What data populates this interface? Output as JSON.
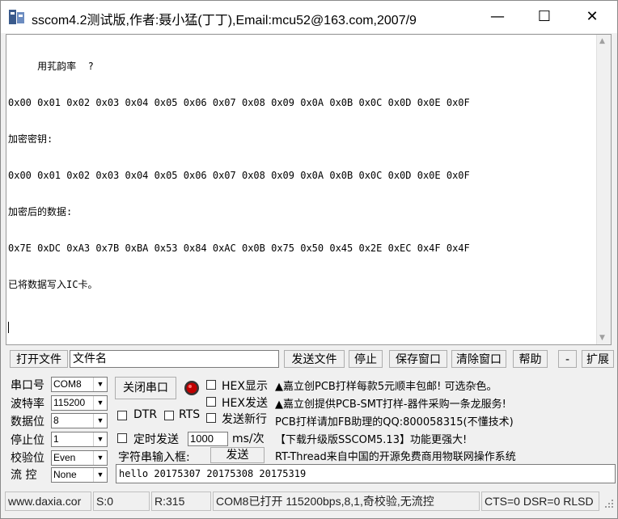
{
  "window": {
    "title": "sscom4.2测试版,作者:聂小猛(丁丁),Email:mcu52@163.com,2007/9",
    "minimize": "—",
    "maximize": "☐",
    "close": "✕"
  },
  "receive": {
    "lines": [
      "     用芤韵率  ?",
      "0x00 0x01 0x02 0x03 0x04 0x05 0x06 0x07 0x08 0x09 0x0A 0x0B 0x0C 0x0D 0x0E 0x0F",
      "加密密钥:",
      "0x00 0x01 0x02 0x03 0x04 0x05 0x06 0x07 0x08 0x09 0x0A 0x0B 0x0C 0x0D 0x0E 0x0F",
      "加密后的数据:",
      "0x7E 0xDC 0xA3 0x7B 0xBA 0x53 0x84 0xAC 0x0B 0x75 0x50 0x45 0x2E 0xEC 0x4F 0x4F",
      "已将数据写入IC卡。"
    ]
  },
  "toolbar": {
    "open_file": "打开文件",
    "file_name": "文件名",
    "send_file": "发送文件",
    "stop": "停止",
    "save_window": "保存窗口",
    "clear_window": "清除窗口",
    "help": "帮助",
    "collapse": "-",
    "expand": "扩展"
  },
  "settings": {
    "port_label": "串口号",
    "port_value": "COM8",
    "baud_label": "波特率",
    "baud_value": "115200",
    "databits_label": "数据位",
    "databits_value": "8",
    "stopbits_label": "停止位",
    "stopbits_value": "1",
    "parity_label": "校验位",
    "parity_value": "Even",
    "flow_label": "流 控",
    "flow_value": "None"
  },
  "controls": {
    "close_port": "关闭串口",
    "hex_display": "HEX显示",
    "hex_send": "HEX发送",
    "dtr": "DTR",
    "rts": "RTS",
    "send_newline": "发送新行",
    "timed_send": "定时发送",
    "interval_value": "1000",
    "interval_unit": "ms/次",
    "input_label": "字符串输入框:",
    "send": "发送",
    "send_text": "hello 20175307 20175308 20175319"
  },
  "ads": [
    "▲嘉立创PCB打样每款5元顺丰包邮! 可选杂色。",
    "▲嘉立创提供PCB-SMT打样-器件采购一条龙服务!",
    "PCB打样请加FB助理的QQ:800058315(不懂技术)",
    "【下载升级版SSCOM5.13】功能更强大!",
    "RT-Thread来自中国的开源免费商用物联网操作系统"
  ],
  "status": {
    "website": "www.daxia.cor",
    "sent": "S:0",
    "received": "R:315",
    "port_info": "COM8已打开  115200bps,8,1,奇校验,无流控",
    "lines": "CTS=0 DSR=0 RLSD"
  },
  "colors": {
    "window_bg": "#f0f0f0",
    "led_red": "#c00000"
  },
  "icons": {
    "app": "serial-port-icon",
    "led": "port-status-led-icon"
  }
}
